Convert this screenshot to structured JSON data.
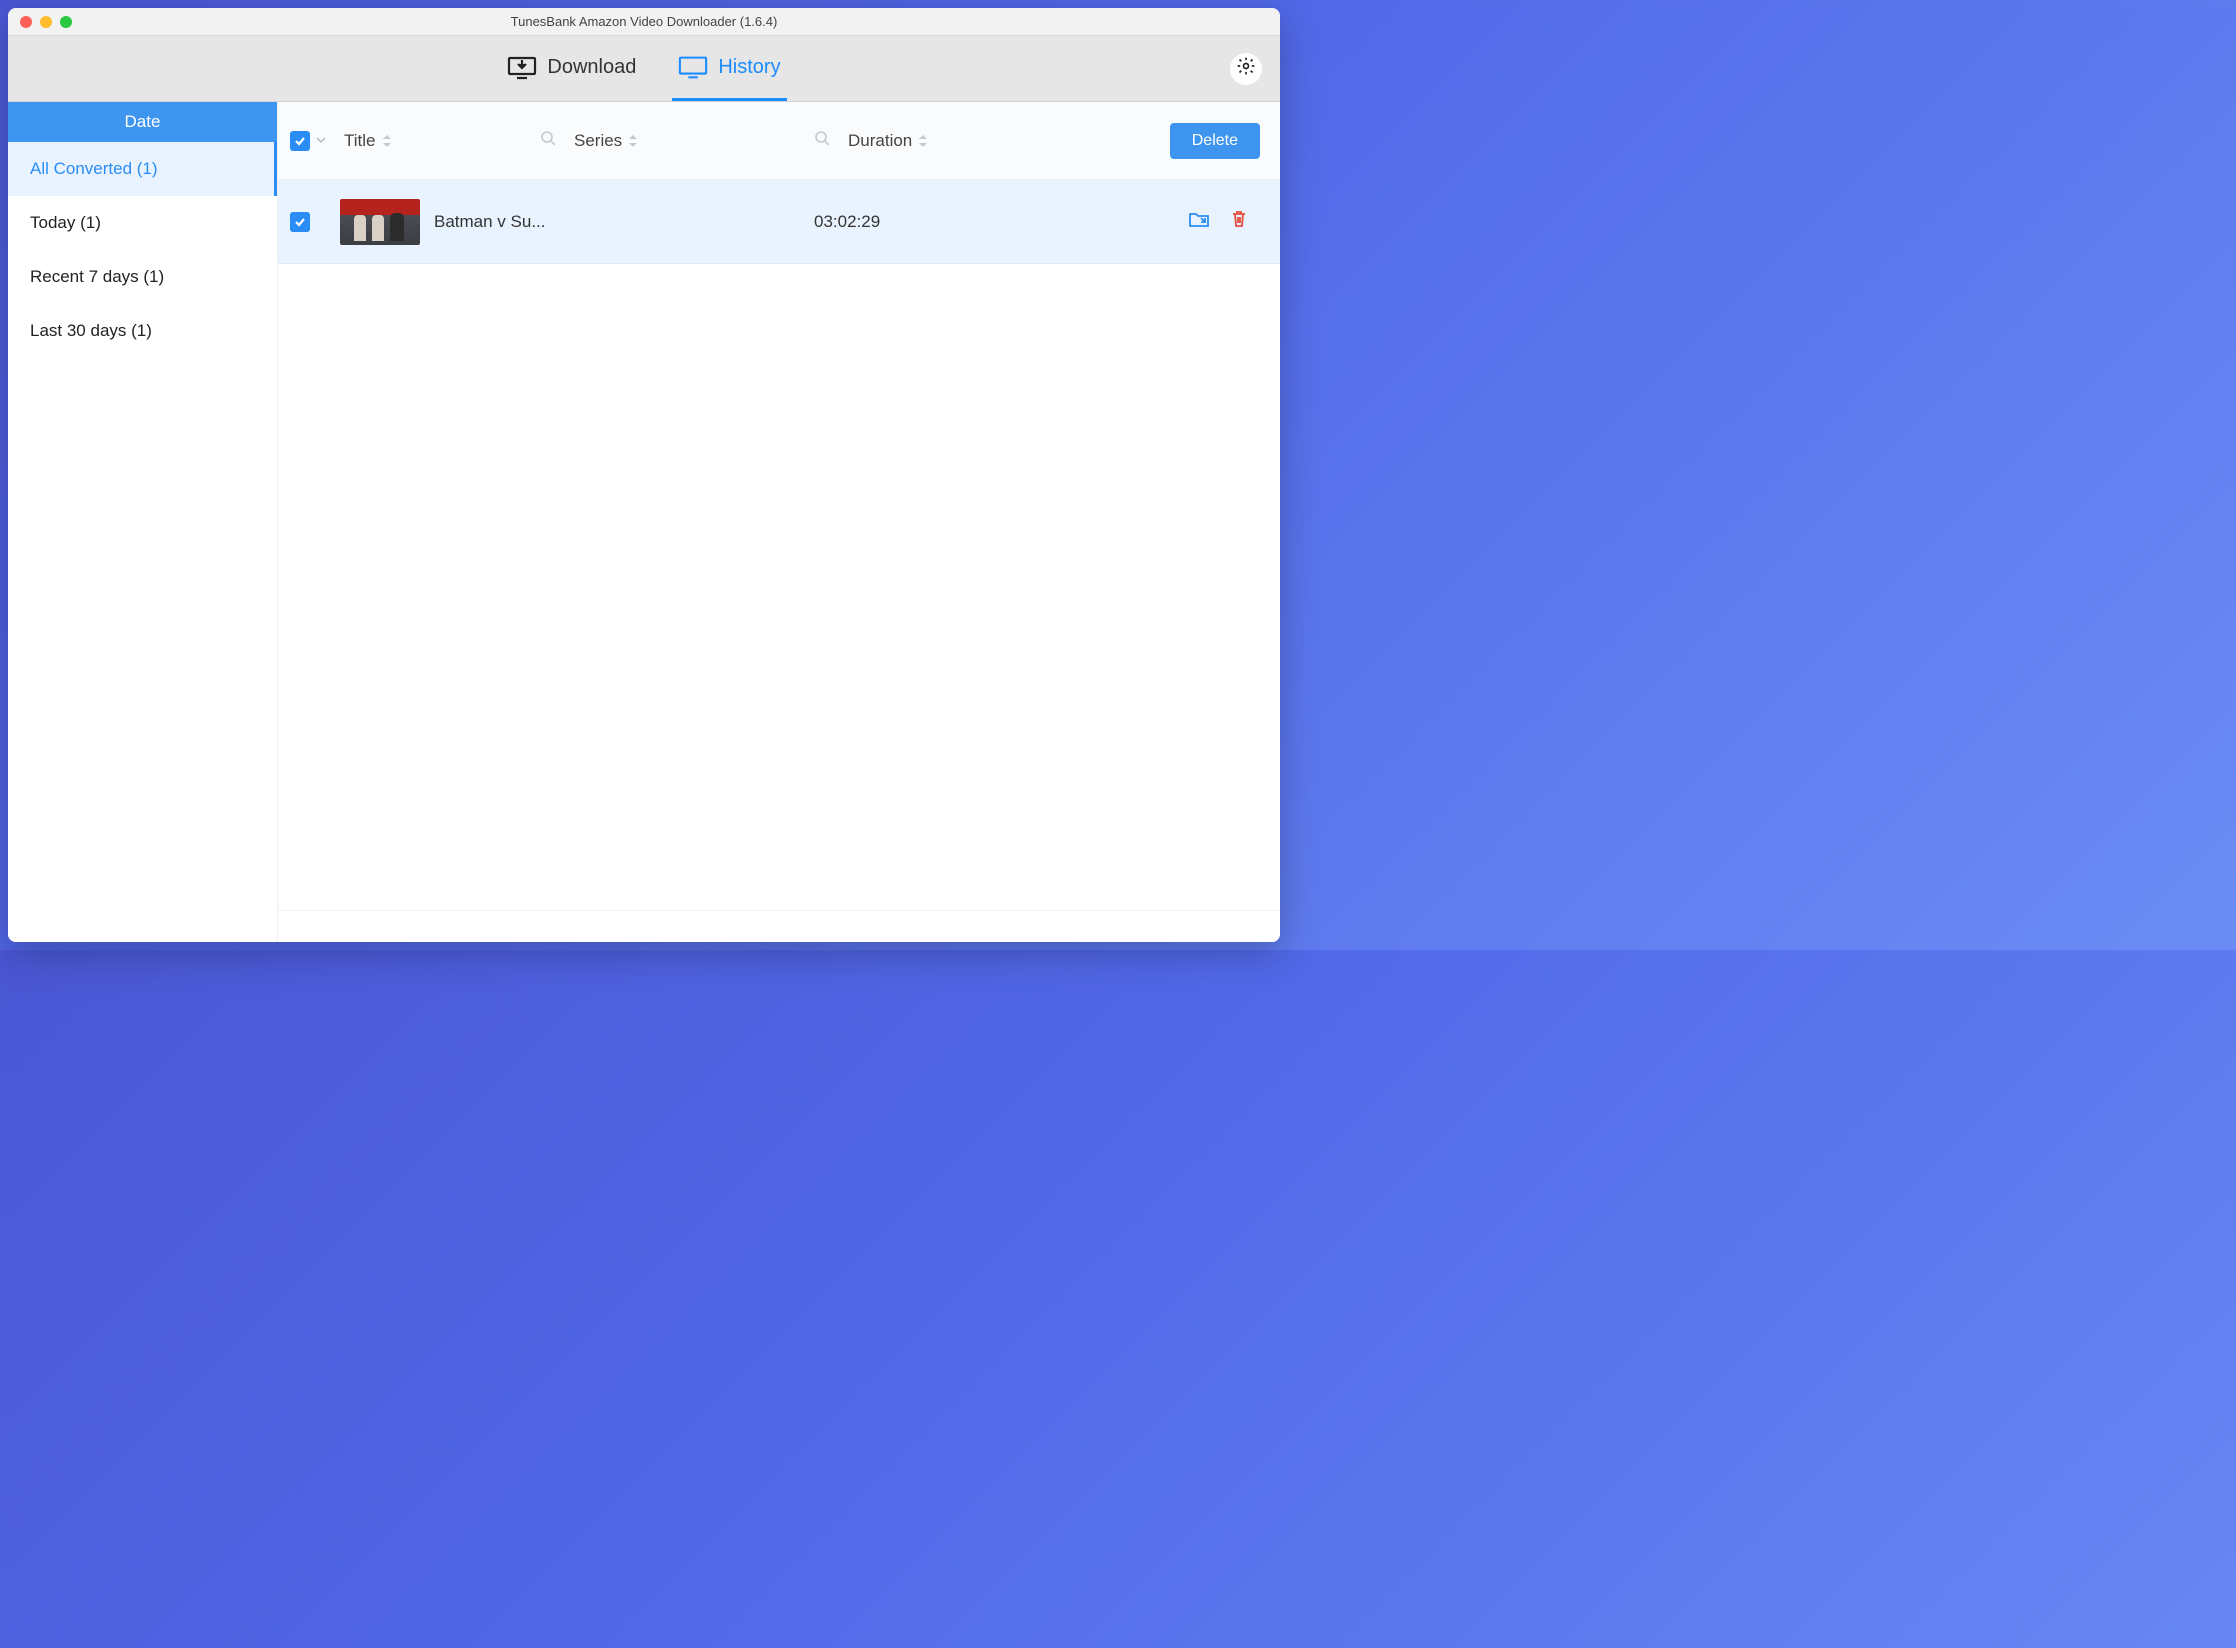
{
  "window": {
    "title": "TunesBank Amazon Video Downloader (1.6.4)"
  },
  "tabs": {
    "download": "Download",
    "history": "History"
  },
  "sidebar": {
    "header": "Date",
    "items": [
      {
        "label": "All Converted (1)",
        "active": true
      },
      {
        "label": "Today (1)"
      },
      {
        "label": "Recent 7 days (1)"
      },
      {
        "label": "Last 30 days (1)"
      }
    ]
  },
  "columns": {
    "title": "Title",
    "series": "Series",
    "duration": "Duration"
  },
  "buttons": {
    "delete": "Delete"
  },
  "rows": [
    {
      "title": "Batman v Su...",
      "series": "",
      "duration": "03:02:29"
    }
  ]
}
